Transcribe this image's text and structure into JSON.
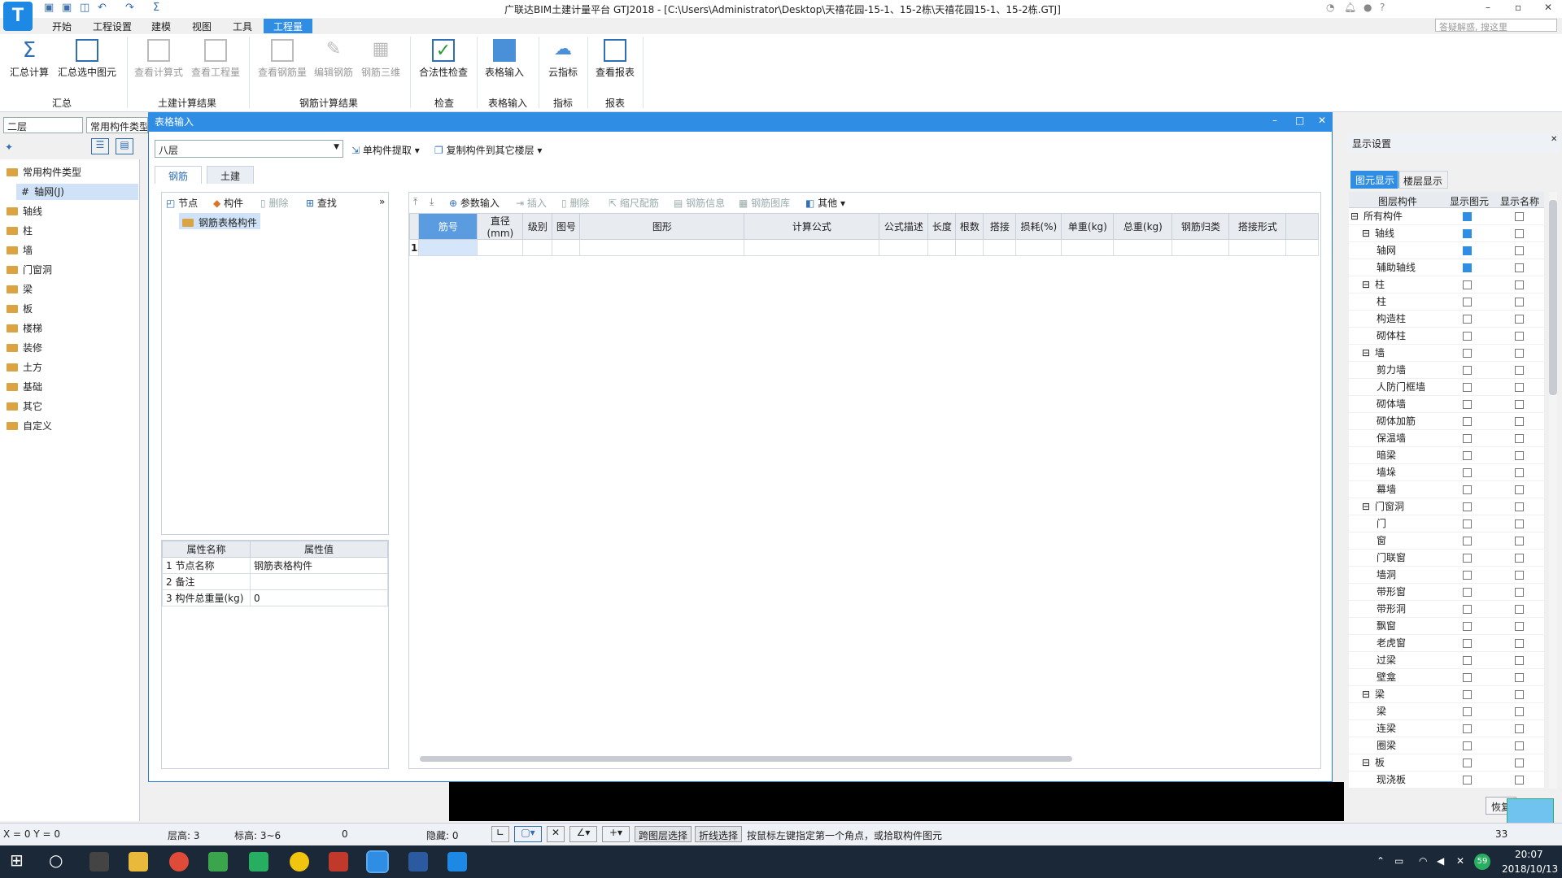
{
  "app": {
    "logo_letter": "T",
    "title": "广联达BIM土建计量平台 GTJ2018 - [C:\\Users\\Administrator\\Desktop\\天禧花园-15-1、15-2栋\\天禧花园15-1、15-2栋.GTJ]",
    "search_placeholder": "答疑解惑, 搜这里"
  },
  "menu": [
    "开始",
    "工程设置",
    "建模",
    "视图",
    "工具",
    "工程量"
  ],
  "ribbon": {
    "buttons": [
      "汇总计算",
      "汇总选中图元",
      "查看计算式",
      "查看工程量",
      "查看钢筋量",
      "编辑钢筋",
      "钢筋三维",
      "合法性检查",
      "表格输入",
      "云指标",
      "查看报表"
    ],
    "groups": [
      "汇总",
      "土建计算结果",
      "钢筋计算结果",
      "检查",
      "表格输入",
      "指标",
      "报表"
    ]
  },
  "left": {
    "floor": "二层",
    "comp": "常用构件类型",
    "tree": [
      "常用构件类型",
      "轴网(J)",
      "轴线",
      "柱",
      "墙",
      "门窗洞",
      "梁",
      "板",
      "楼梯",
      "装修",
      "土方",
      "基础",
      "其它",
      "自定义"
    ]
  },
  "dialog": {
    "title": "表格输入",
    "floor": "八层",
    "extract": "单构件提取",
    "copy": "复制构件到其它楼层",
    "tabs": [
      "钢筋",
      "土建"
    ],
    "left_toolbar": [
      "节点",
      "构件",
      "删除",
      "查找"
    ],
    "node": "钢筋表格构件",
    "prop_headers": [
      "属性名称",
      "属性值"
    ],
    "props": [
      {
        "n": "1 节点名称",
        "v": "钢筋表格构件"
      },
      {
        "n": "2 备注",
        "v": ""
      },
      {
        "n": "3 构件总重量(kg)",
        "v": "0"
      }
    ],
    "grid_toolbar": [
      "参数输入",
      "插入",
      "删除",
      "缩尺配筋",
      "钢筋信息",
      "钢筋图库",
      "其他"
    ],
    "columns": [
      "筋号",
      "直径(mm)",
      "级别",
      "图号",
      "图形",
      "计算公式",
      "公式描述",
      "长度",
      "根数",
      "搭接",
      "损耗(%)",
      "单重(kg)",
      "总重(kg)",
      "钢筋归类",
      "搭接形式"
    ],
    "row_num": "1"
  },
  "right": {
    "title": "显示设置",
    "tabs": [
      "图元显示",
      "楼层显示"
    ],
    "headers": [
      "图层构件",
      "显示图元",
      "显示名称"
    ],
    "rows": [
      {
        "l": "所有构件",
        "lv": 0,
        "g": "on",
        "n": ""
      },
      {
        "l": "轴线",
        "lv": 1,
        "g": "on",
        "n": ""
      },
      {
        "l": "轴网",
        "lv": 2,
        "g": "on",
        "n": ""
      },
      {
        "l": "辅助轴线",
        "lv": 2,
        "g": "on",
        "n": ""
      },
      {
        "l": "柱",
        "lv": 1,
        "g": "",
        "n": ""
      },
      {
        "l": "柱",
        "lv": 2,
        "g": "",
        "n": ""
      },
      {
        "l": "构造柱",
        "lv": 2,
        "g": "",
        "n": ""
      },
      {
        "l": "砌体柱",
        "lv": 2,
        "g": "",
        "n": ""
      },
      {
        "l": "墙",
        "lv": 1,
        "g": "",
        "n": ""
      },
      {
        "l": "剪力墙",
        "lv": 2,
        "g": "",
        "n": ""
      },
      {
        "l": "人防门框墙",
        "lv": 2,
        "g": "",
        "n": ""
      },
      {
        "l": "砌体墙",
        "lv": 2,
        "g": "",
        "n": ""
      },
      {
        "l": "砌体加筋",
        "lv": 2,
        "g": "",
        "n": ""
      },
      {
        "l": "保温墙",
        "lv": 2,
        "g": "",
        "n": ""
      },
      {
        "l": "暗梁",
        "lv": 2,
        "g": "",
        "n": ""
      },
      {
        "l": "墙垛",
        "lv": 2,
        "g": "",
        "n": ""
      },
      {
        "l": "幕墙",
        "lv": 2,
        "g": "",
        "n": ""
      },
      {
        "l": "门窗洞",
        "lv": 1,
        "g": "",
        "n": ""
      },
      {
        "l": "门",
        "lv": 2,
        "g": "",
        "n": ""
      },
      {
        "l": "窗",
        "lv": 2,
        "g": "",
        "n": ""
      },
      {
        "l": "门联窗",
        "lv": 2,
        "g": "",
        "n": ""
      },
      {
        "l": "墙洞",
        "lv": 2,
        "g": "",
        "n": ""
      },
      {
        "l": "带形窗",
        "lv": 2,
        "g": "",
        "n": ""
      },
      {
        "l": "带形洞",
        "lv": 2,
        "g": "",
        "n": ""
      },
      {
        "l": "飘窗",
        "lv": 2,
        "g": "",
        "n": ""
      },
      {
        "l": "老虎窗",
        "lv": 2,
        "g": "",
        "n": ""
      },
      {
        "l": "过梁",
        "lv": 2,
        "g": "",
        "n": ""
      },
      {
        "l": "壁龛",
        "lv": 2,
        "g": "",
        "n": ""
      },
      {
        "l": "梁",
        "lv": 1,
        "g": "",
        "n": ""
      },
      {
        "l": "梁",
        "lv": 2,
        "g": "",
        "n": ""
      },
      {
        "l": "连梁",
        "lv": 2,
        "g": "",
        "n": ""
      },
      {
        "l": "圈梁",
        "lv": 2,
        "g": "",
        "n": ""
      },
      {
        "l": "板",
        "lv": 1,
        "g": "",
        "n": ""
      },
      {
        "l": "现浇板",
        "lv": 2,
        "g": "",
        "n": ""
      }
    ],
    "restore": "恢复"
  },
  "status": {
    "coords": "X = 0 Y = 0",
    "floor_h": "层高:  3",
    "elev": "标高: 3~6",
    "val": "0",
    "hidden": "隐藏:  0",
    "cross": "跨图层选择",
    "polyline": "折线选择",
    "hint": "按鼠标左键指定第一个角点，或拾取构件图元",
    "right": "33"
  },
  "clock": {
    "time": "20:07",
    "date": "2018/10/13",
    "badge": "59"
  }
}
